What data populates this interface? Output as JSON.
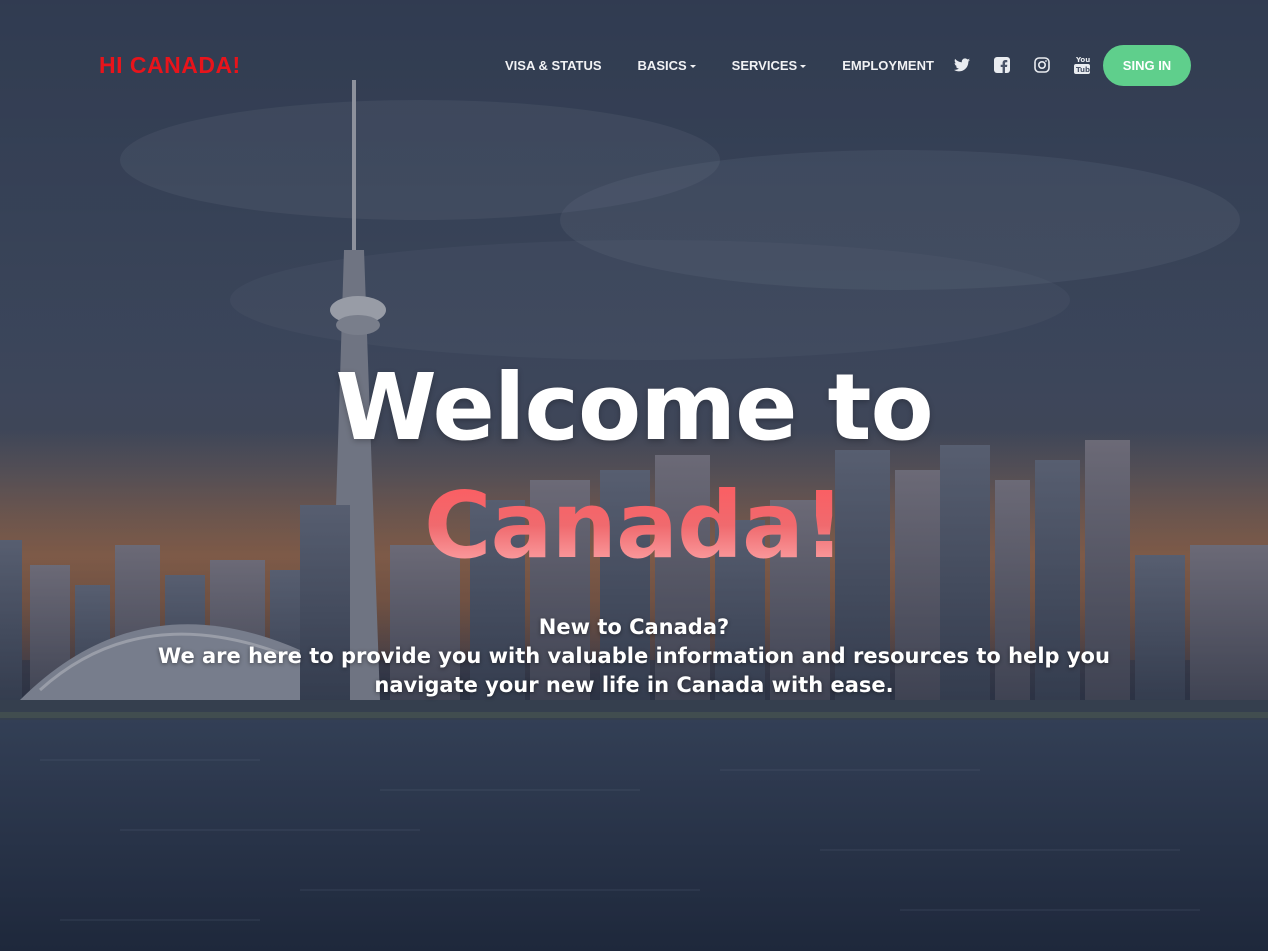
{
  "brand": {
    "logo_text": "HI CANADA!",
    "logo_color": "#e8141b"
  },
  "nav": {
    "items": [
      {
        "label": "VISA & STATUS",
        "dropdown": false
      },
      {
        "label": "BASICS",
        "dropdown": true
      },
      {
        "label": "SERVICES",
        "dropdown": true
      },
      {
        "label": "EMPLOYMENT",
        "dropdown": false
      }
    ],
    "social": [
      "twitter-icon",
      "facebook-icon",
      "instagram-icon",
      "youtube-icon"
    ],
    "signin_label": "SING IN",
    "signin_color": "#5fcf8c"
  },
  "hero": {
    "title_line1": "Welcome to",
    "title_line2": "Canada!",
    "subtitle_line1": "New to Canada?",
    "subtitle_line2": "We are here to provide you with valuable information and resources to help you navigate your new life in Canada with ease.",
    "accent_color": "#f0555b"
  }
}
